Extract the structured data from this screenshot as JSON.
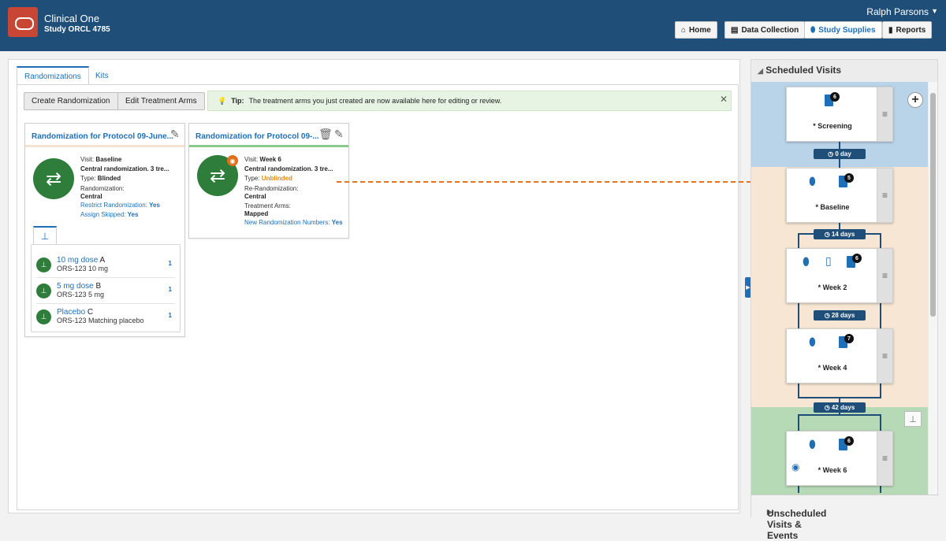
{
  "header": {
    "app_title": "Clinical One",
    "study": "Study ORCL 4785",
    "user": "Ralph Parsons",
    "nav": [
      {
        "label": "Home",
        "icon": "home-icon"
      },
      {
        "label": "Data Collection",
        "icon": "clipboard-icon"
      },
      {
        "label": "Study Supplies",
        "icon": "pill-icon"
      },
      {
        "label": "Reports",
        "icon": "bar-chart-icon"
      }
    ],
    "active_nav": "Study Supplies",
    "brand_color": "#1f4e79",
    "logo_color": "#c74634"
  },
  "tabs": [
    "Randomizations",
    "Kits"
  ],
  "active_tab": "Randomizations",
  "toolbar": {
    "create": "Create Randomization",
    "edit_arms": "Edit Treatment Arms"
  },
  "tip": {
    "label": "Tip:",
    "text": "The treatment arms you just created are now available here for editing or review."
  },
  "cards": [
    {
      "title": "Randomization for Protocol 09-June...",
      "accent": "#f5e3cf",
      "rows": [
        {
          "label": "Visit: ",
          "value": "Baseline"
        },
        {
          "label": "",
          "value": "Central randomization. 3 tre..."
        },
        {
          "label": "Type: ",
          "value": "Blinded"
        },
        {
          "label": "Randomization:",
          "value": ""
        },
        {
          "label": "",
          "value": "Central"
        },
        {
          "label": "Restrict Randomization: ",
          "value": "Yes"
        },
        {
          "label": "Assign Skipped: ",
          "value": "Yes"
        }
      ],
      "arms": [
        {
          "name": "10 mg dose",
          "code": "A",
          "desc": "ORS-123 10 mg",
          "count": "1"
        },
        {
          "name": "5 mg dose",
          "code": "B",
          "desc": "ORS-123 5 mg",
          "count": "1"
        },
        {
          "name": "Placebo",
          "code": "C",
          "desc": "ORS-123 Matching placebo",
          "count": "1"
        }
      ]
    },
    {
      "title": "Randomization for Protocol 09-...",
      "accent": "#8cc98c",
      "rows": [
        {
          "label": "Visit: ",
          "value": "Week 6"
        },
        {
          "label": "",
          "value": "Central randomization. 3 tre..."
        },
        {
          "label": "Type: ",
          "value": "Unblinded"
        },
        {
          "label": "Re-Randomization:",
          "value": ""
        },
        {
          "label": "",
          "value": "Central"
        },
        {
          "label": "Treatment Arms:",
          "value": ""
        },
        {
          "label": "",
          "value": "Mapped"
        },
        {
          "label": "New Randomization Numbers: ",
          "value": "Yes"
        }
      ]
    }
  ],
  "scheduled": {
    "title": "Scheduled Visits",
    "bands": [
      {
        "name": "screening-band",
        "color": "#b9d3e8"
      },
      {
        "name": "treatment-band",
        "color": "#f6e6d3"
      },
      {
        "name": "followup-band",
        "color": "#b6d9b6"
      }
    ],
    "visits": [
      {
        "name": "* Screening",
        "forms": "6",
        "dispense": false
      },
      {
        "name": "* Baseline",
        "forms": "5",
        "dispense": true
      },
      {
        "name": "* Week 2",
        "forms": "6",
        "dispense": true,
        "device": true
      },
      {
        "name": "* Week 4",
        "forms": "7",
        "dispense": true
      },
      {
        "name": "* Week 6",
        "forms": "6",
        "dispense": true,
        "unblind": true
      }
    ],
    "intervals": [
      "0 day",
      "14 days",
      "28 days",
      "42 days"
    ]
  },
  "unscheduled": {
    "title": "Unscheduled Visits & Events"
  }
}
